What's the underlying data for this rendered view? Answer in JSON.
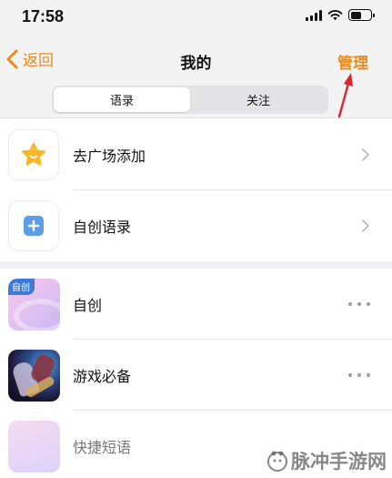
{
  "status_bar": {
    "time": "17:58"
  },
  "nav": {
    "back_label": "返回",
    "title": "我的",
    "manage_label": "管理"
  },
  "tabs": [
    {
      "label": "语录",
      "active": true
    },
    {
      "label": "关注",
      "active": false
    }
  ],
  "top_items": [
    {
      "label": "去广场添加",
      "icon": "star-icon"
    },
    {
      "label": "自创语录",
      "icon": "plus-square-icon"
    }
  ],
  "collections": [
    {
      "label": "自创",
      "badge": "自创",
      "cover": "gradient-pink-purple"
    },
    {
      "label": "游戏必备",
      "cover": "game-art"
    },
    {
      "label": "快捷短语",
      "cover": "gradient-pink-lavender"
    }
  ],
  "watermark": {
    "text": "脉冲手游网"
  },
  "colors": {
    "accent": "#ec8a1c",
    "star": "#f5b82e",
    "plus": "#5b9ee6",
    "badge": "#3f7bd6",
    "annotation_arrow": "#d8262c"
  }
}
